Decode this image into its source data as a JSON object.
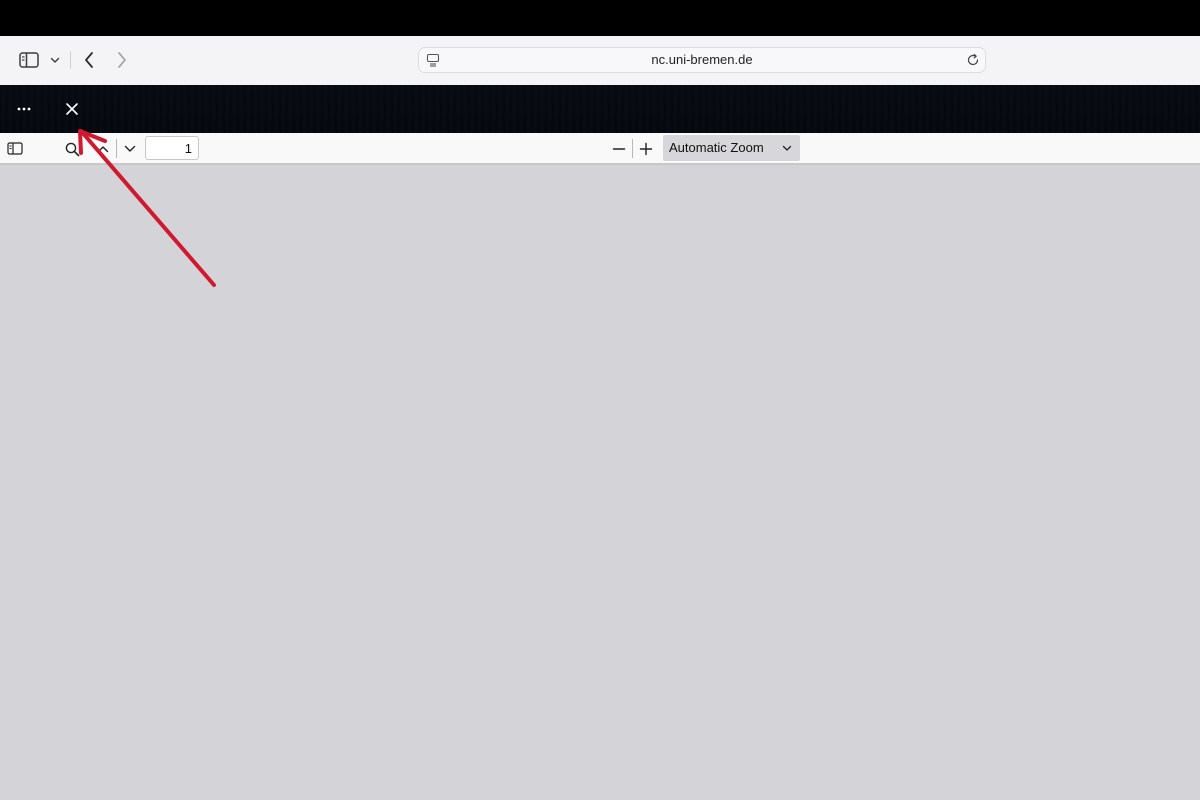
{
  "browser": {
    "url": "nc.uni-bremen.de"
  },
  "icons": {
    "sidebar": "sidebar-toggle-icon",
    "sidebar_menu": "chevron-down-icon",
    "back": "chevron-left-icon",
    "forward": "chevron-right-icon",
    "site": "page-icon",
    "reload": "reload-icon",
    "more": "more-icon",
    "close": "close-icon",
    "pdf_sidebar": "sidebar-toggle-icon",
    "find": "search-icon",
    "prev_page": "chevron-up-icon",
    "next_page": "chevron-down-icon",
    "zoom_out": "minus-icon",
    "zoom_in": "plus-icon"
  },
  "pdf_viewer": {
    "page_number": "1",
    "zoom_label": "Automatic Zoom"
  },
  "colors": {
    "annotation_arrow": "#d0192f",
    "viewer_background": "#d4d3d8",
    "header_background": "#03070d"
  }
}
